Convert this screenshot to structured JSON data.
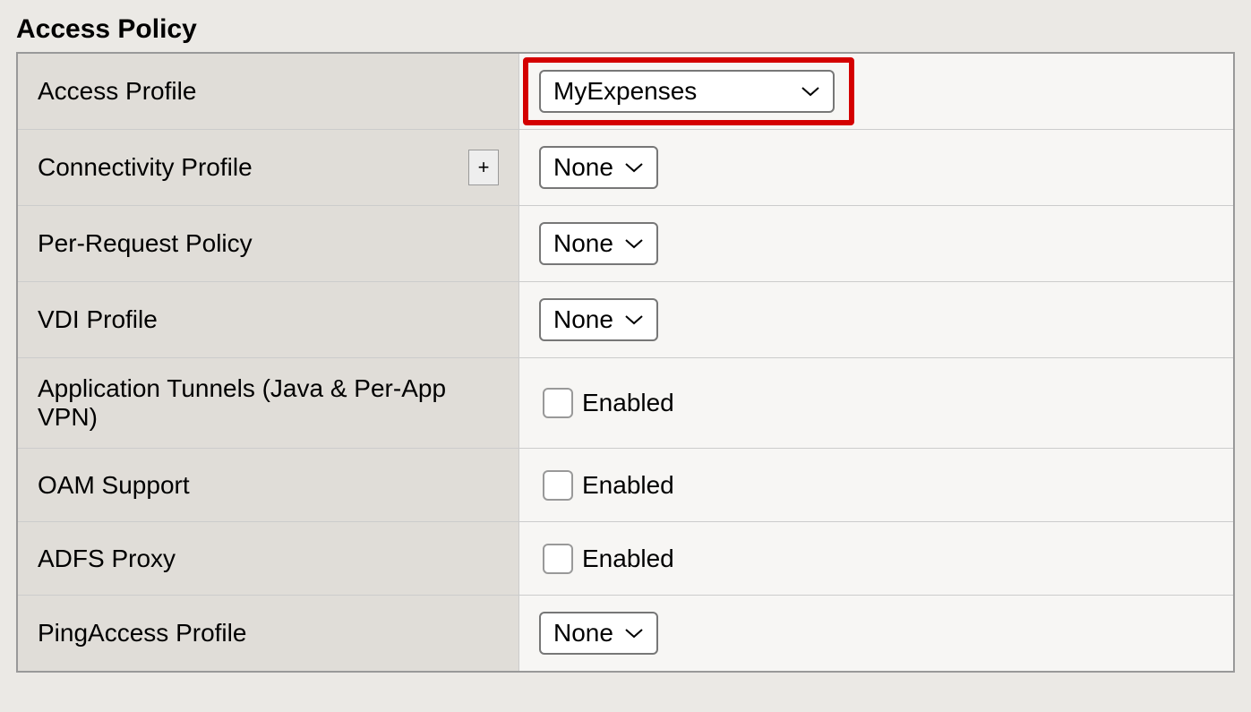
{
  "section_title": "Access Policy",
  "rows": {
    "access_profile": {
      "label": "Access Profile",
      "value": "MyExpenses"
    },
    "connectivity_profile": {
      "label": "Connectivity Profile",
      "value": "None",
      "plus": "+"
    },
    "per_request_policy": {
      "label": "Per-Request Policy",
      "value": "None"
    },
    "vdi_profile": {
      "label": "VDI Profile",
      "value": "None"
    },
    "app_tunnels": {
      "label": "Application Tunnels (Java & Per-App VPN)",
      "checkbox_label": "Enabled"
    },
    "oam_support": {
      "label": "OAM Support",
      "checkbox_label": "Enabled"
    },
    "adfs_proxy": {
      "label": "ADFS Proxy",
      "checkbox_label": "Enabled"
    },
    "pingaccess_profile": {
      "label": "PingAccess Profile",
      "value": "None"
    }
  }
}
